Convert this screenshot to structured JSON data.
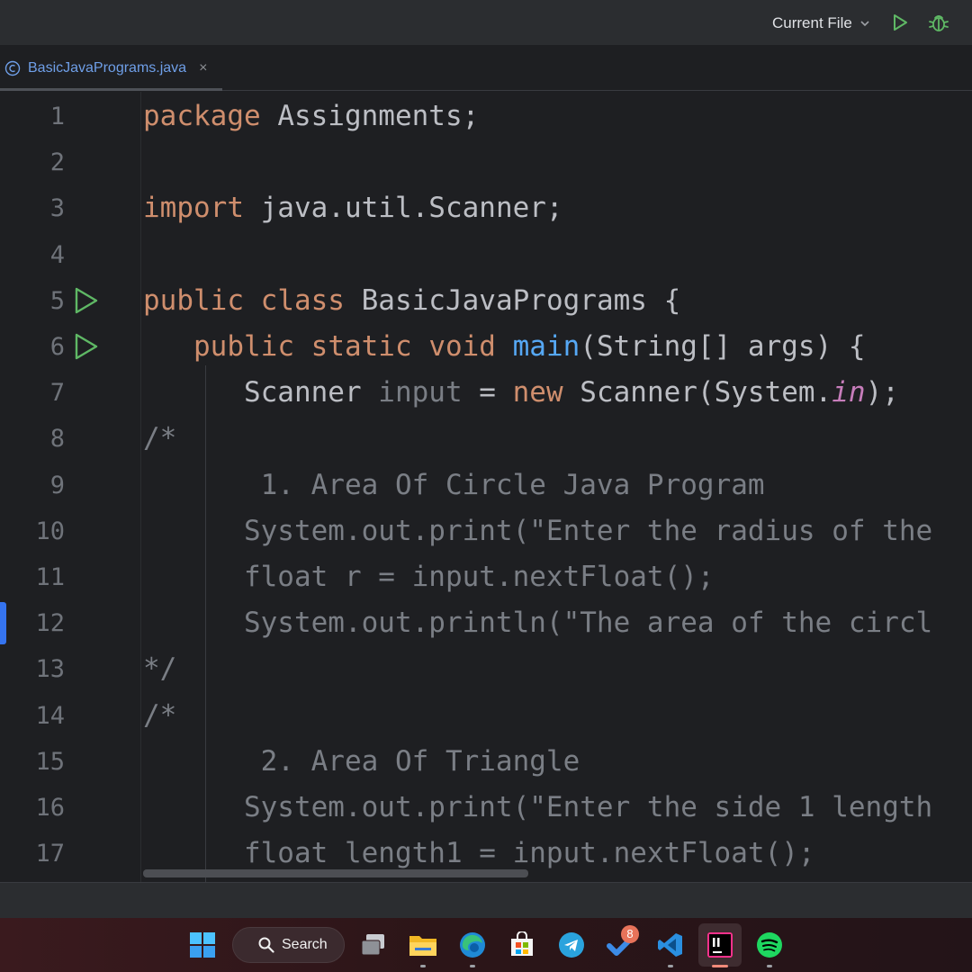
{
  "toolbar": {
    "run_config_label": "Current File",
    "run_icon": "play-icon",
    "debug_icon": "bug-icon"
  },
  "tab": {
    "icon": "java-class-icon",
    "label": "BasicJavaPrograms.java",
    "close_glyph": "×"
  },
  "gutter": {
    "line_numbers": [
      "1",
      "2",
      "3",
      "4",
      "5",
      "6",
      "7",
      "8",
      "9",
      "10",
      "11",
      "12",
      "13",
      "14",
      "15",
      "16",
      "17"
    ],
    "run_markers_on_lines": [
      5,
      6
    ]
  },
  "code": {
    "l1": {
      "kw": "package",
      "rest": " Assignments;"
    },
    "l3": {
      "kw": "import",
      "rest": " java.util.Scanner;"
    },
    "l5": {
      "kw1": "public",
      "sp": " ",
      "kw2": "class",
      "rest": " BasicJavaPrograms {"
    },
    "l6": {
      "indent": "   ",
      "kw1": "public",
      "kw2": "static",
      "kw3": "void",
      "fn": "main",
      "rest": "(String[] args) {"
    },
    "l7": {
      "indent": "      ",
      "type": "Scanner ",
      "var": "input",
      "eq": " = ",
      "kw": "new",
      "call": " Scanner(System.",
      "field": "in",
      "end": ");"
    },
    "l8": "/*",
    "l9": "       1. Area Of Circle Java Program",
    "l10": "      System.out.print(\"Enter the radius of the",
    "l11": "      float r = input.nextFloat();",
    "l12": "      System.out.println(\"The area of the circl",
    "l13": "*/",
    "l14": "/*",
    "l15": "       2. Area Of Triangle",
    "l16": "      System.out.print(\"Enter the side 1 length",
    "l17": "      float length1 = input.nextFloat();"
  },
  "taskbar": {
    "start_icon": "windows-start-icon",
    "search_label": "Search",
    "items": [
      "task-view-icon",
      "file-explorer-icon",
      "edge-browser-icon",
      "microsoft-store-icon",
      "telegram-icon",
      "todo-icon",
      "vscode-icon",
      "intellij-icon",
      "spotify-icon"
    ],
    "todo_badge": "8"
  },
  "colors": {
    "background": "#1e1f22",
    "keyword": "#cf8e6d",
    "function": "#56a8f5",
    "static_field": "#c77dbb",
    "comment": "#7a7e85",
    "run_green": "#5fb865",
    "tab_text": "#6f9fe8"
  }
}
